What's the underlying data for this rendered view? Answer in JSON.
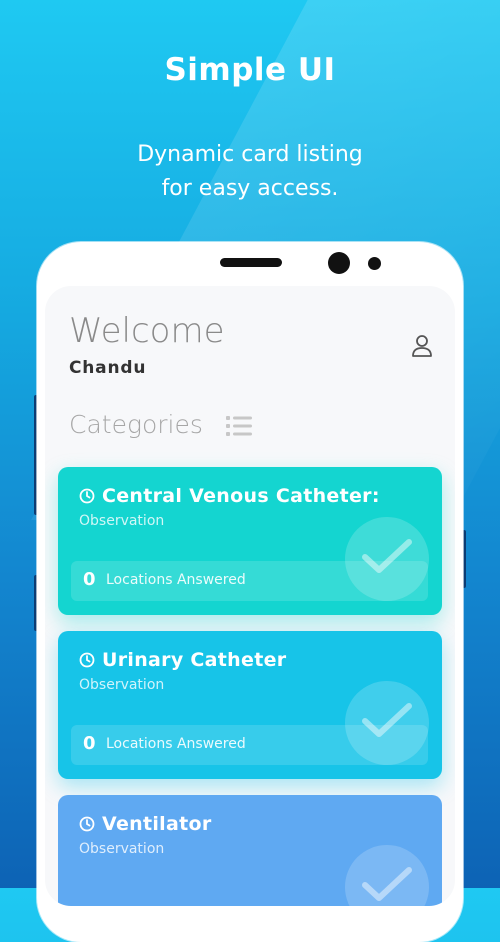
{
  "promo": {
    "title": "Simple UI",
    "subtitle_line1": "Dynamic card listing",
    "subtitle_line2": "for easy access."
  },
  "app": {
    "welcome": "Welcome",
    "username": "Chandu",
    "categories_label": "Categories"
  },
  "cards": [
    {
      "title": "Central Venous Catheter:",
      "subtitle": "Observation",
      "count": "0",
      "count_label": "Locations Answered",
      "color": "#14d5d0"
    },
    {
      "title": "Urinary Catheter",
      "subtitle": "Observation",
      "count": "0",
      "count_label": "Locations Answered",
      "color": "#17c4e8"
    },
    {
      "title": "Ventilator",
      "subtitle": "Observation",
      "count": "",
      "count_label": "",
      "color": "#5fa9f2"
    }
  ],
  "icons": {
    "profile": "user-icon",
    "list": "list-icon",
    "clock": "clock-icon",
    "check": "check-icon"
  }
}
